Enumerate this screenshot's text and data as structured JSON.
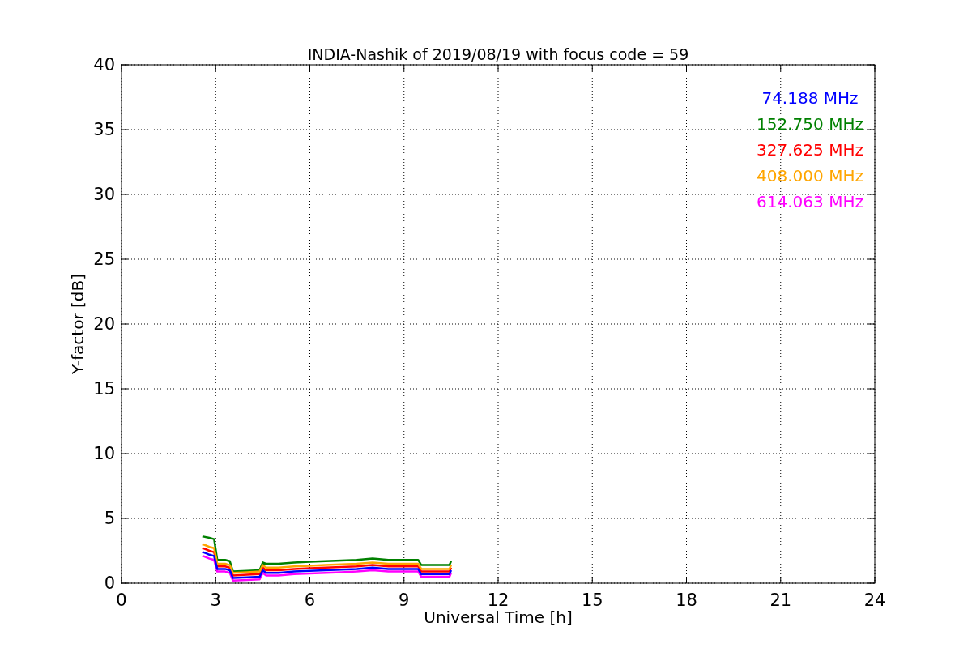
{
  "chart_data": {
    "type": "line",
    "title": "INDIA-Nashik of 2019/08/19 with focus code = 59",
    "xlabel": "Universal Time [h]",
    "ylabel": "Y-factor [dB]",
    "grid": true,
    "x": [
      2.6,
      2.8,
      2.95,
      3.05,
      3.3,
      3.45,
      3.55,
      4.0,
      4.4,
      4.5,
      4.6,
      5.0,
      5.5,
      6.0,
      6.5,
      7.0,
      7.5,
      8.0,
      8.5,
      9.0,
      9.45,
      9.55,
      10.0,
      10.45,
      10.5
    ],
    "series": [
      {
        "name": "74.188 MHz",
        "color": "#0000ff",
        "values": [
          2.4,
          2.2,
          2.1,
          1.1,
          1.1,
          1.0,
          0.4,
          0.45,
          0.5,
          1.0,
          0.8,
          0.8,
          0.9,
          0.95,
          1.0,
          1.05,
          1.1,
          1.2,
          1.1,
          1.1,
          1.1,
          0.7,
          0.7,
          0.7,
          1.0
        ]
      },
      {
        "name": "152.750 MHz",
        "color": "#008000",
        "values": [
          3.6,
          3.5,
          3.4,
          1.8,
          1.8,
          1.7,
          0.9,
          0.95,
          1.0,
          1.6,
          1.5,
          1.5,
          1.6,
          1.65,
          1.7,
          1.75,
          1.8,
          1.9,
          1.8,
          1.8,
          1.8,
          1.4,
          1.4,
          1.4,
          1.7
        ]
      },
      {
        "name": "327.625 MHz",
        "color": "#ff0000",
        "values": [
          2.7,
          2.5,
          2.4,
          1.3,
          1.3,
          1.2,
          0.6,
          0.65,
          0.7,
          1.2,
          1.0,
          1.0,
          1.1,
          1.15,
          1.2,
          1.25,
          1.3,
          1.4,
          1.3,
          1.3,
          1.3,
          0.9,
          0.9,
          0.9,
          1.2
        ]
      },
      {
        "name": "408.000 MHz",
        "color": "#ffa500",
        "values": [
          3.0,
          2.8,
          2.7,
          1.5,
          1.5,
          1.4,
          0.8,
          0.85,
          0.9,
          1.4,
          1.2,
          1.2,
          1.3,
          1.35,
          1.4,
          1.45,
          1.5,
          1.6,
          1.5,
          1.5,
          1.5,
          1.1,
          1.1,
          1.1,
          1.4
        ]
      },
      {
        "name": "614.063 MHz",
        "color": "#ff00ff",
        "values": [
          2.1,
          1.9,
          1.8,
          0.9,
          0.9,
          0.8,
          0.2,
          0.25,
          0.3,
          0.8,
          0.6,
          0.6,
          0.7,
          0.75,
          0.8,
          0.85,
          0.9,
          1.0,
          0.9,
          0.9,
          0.9,
          0.5,
          0.5,
          0.5,
          0.8
        ]
      }
    ],
    "xlim": [
      0,
      24
    ],
    "ylim": [
      0,
      40
    ],
    "xticks": [
      0,
      3,
      6,
      9,
      12,
      15,
      18,
      21,
      24
    ],
    "yticks": [
      0,
      5,
      10,
      15,
      20,
      25,
      30,
      35,
      40
    ]
  }
}
